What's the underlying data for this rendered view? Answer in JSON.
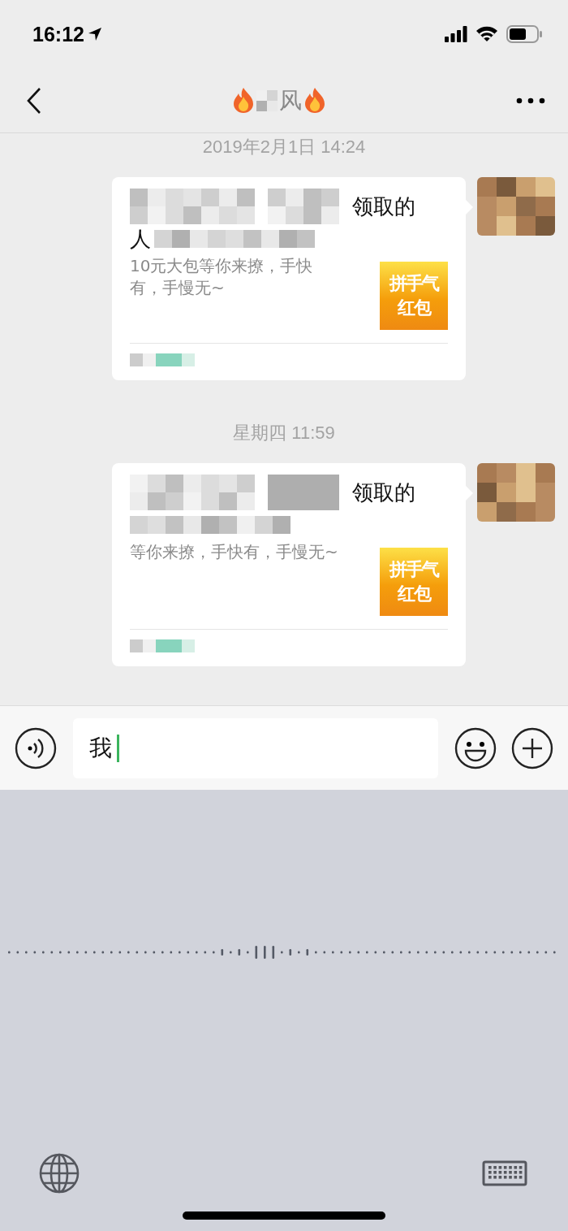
{
  "status_bar": {
    "time": "16:12"
  },
  "nav": {
    "title": "风"
  },
  "messages": [
    {
      "timestamp": "2019年2月1日 14:24",
      "card": {
        "title_end": "领取的",
        "title_line2": "人",
        "description": "10元大包等你来撩，手快有，手慢无~",
        "thumbnail": [
          "拼手气",
          "红包"
        ]
      }
    },
    {
      "timestamp": "星期四 11:59",
      "card": {
        "title_end": "领取的",
        "description": "等你来撩，手快有，手慢无~",
        "thumbnail": [
          "拼手气",
          "红包"
        ]
      }
    }
  ],
  "composer": {
    "value": "我"
  }
}
